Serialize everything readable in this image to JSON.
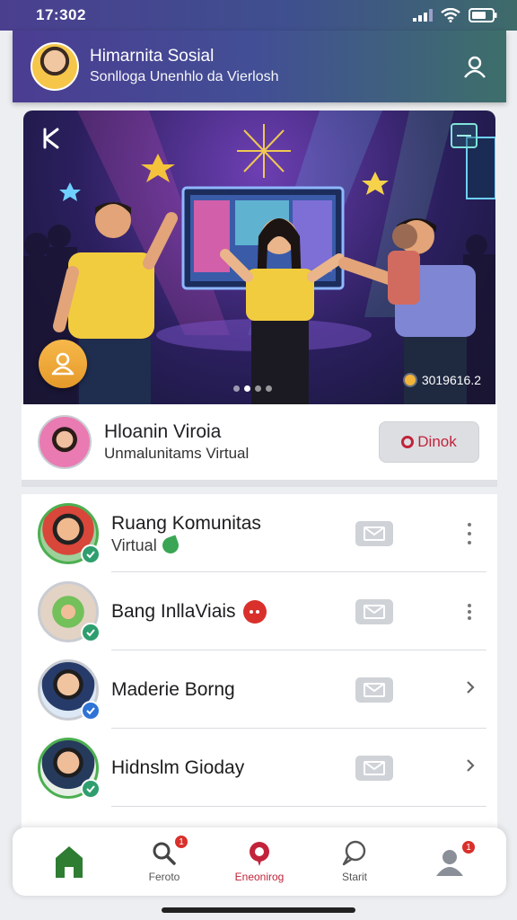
{
  "status_bar": {
    "time": "17:302"
  },
  "header": {
    "title": "Himarnita Sosial",
    "subtitle": "Sonlloga Unenhlo da Vierlosh"
  },
  "hero": {
    "count_text": "3019616.2",
    "carousel_dots": 4,
    "active_dot": 1
  },
  "featured": {
    "title": "Hloanin Viroia",
    "subtitle": "Unmalunitams Virtual",
    "action_label": "Dinok"
  },
  "list": [
    {
      "title": "Ruang Komunitas",
      "subtitle": "Virtual",
      "avatar": "avatar-a",
      "badge": "green",
      "trailing": "more"
    },
    {
      "title": "Bang InllaViais",
      "subtitle": "",
      "avatar": "avatar-b",
      "badge": "green",
      "trailing": "more"
    },
    {
      "title": "Maderie Borng",
      "subtitle": "",
      "avatar": "avatar-c",
      "badge": "blue",
      "trailing": "chevron"
    },
    {
      "title": "Hidnslm Gioday",
      "subtitle": "",
      "avatar": "avatar-d",
      "badge": "green",
      "trailing": "chevron"
    }
  ],
  "nav": [
    {
      "label": "",
      "icon": "home-icon"
    },
    {
      "label": "Feroto",
      "icon": "search-icon",
      "badge": "1"
    },
    {
      "label": "Eneonirog",
      "icon": "pin-icon"
    },
    {
      "label": "Starit",
      "icon": "chat-icon"
    },
    {
      "label": "",
      "icon": "profile-icon",
      "badge": "1"
    }
  ],
  "colors": {
    "accent_red": "#c2233a",
    "header_start": "#4b3d92",
    "header_end": "#3d6f6a",
    "home_green": "#2e7d32"
  }
}
